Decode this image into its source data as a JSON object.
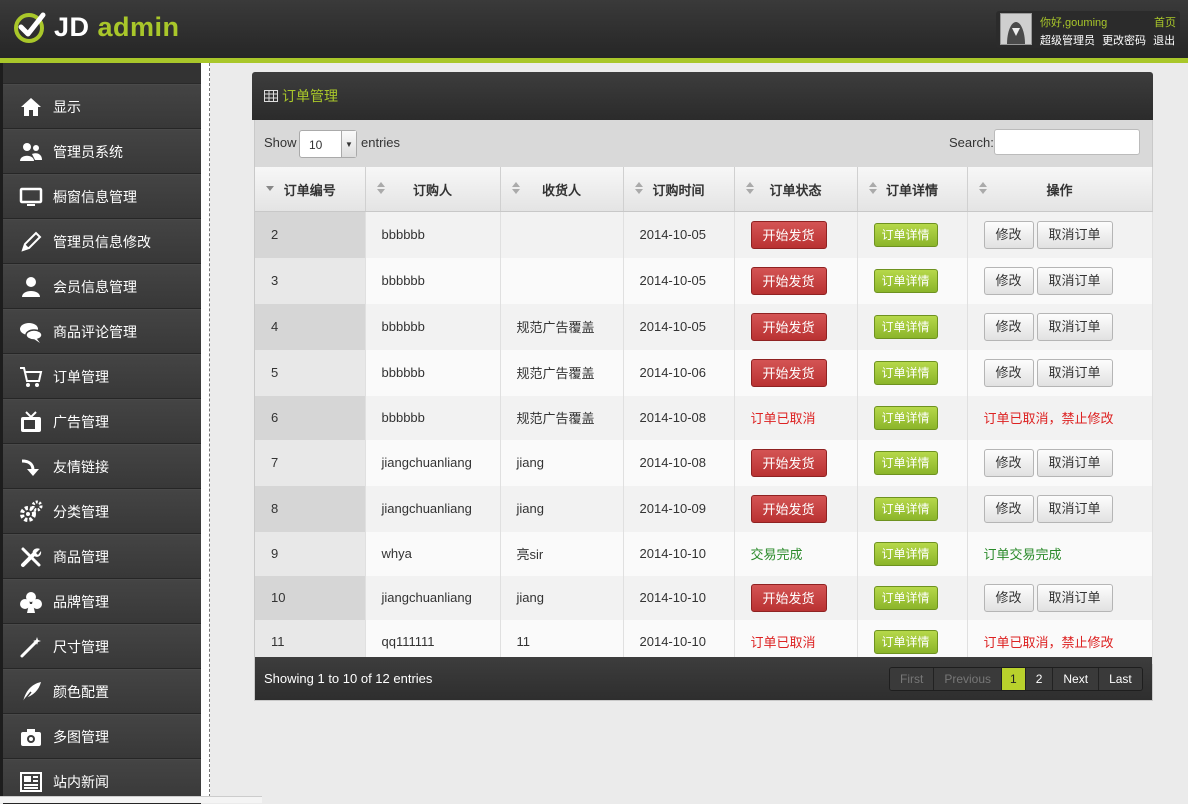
{
  "header": {
    "brand_main": "JD",
    "brand_accent": "admin",
    "greeting": "你好,gouming",
    "home": "首页",
    "role": "超级管理员",
    "change_password": "更改密码",
    "logout": "退出"
  },
  "sidebar": {
    "items": [
      {
        "label": "显示",
        "icon": "home-icon"
      },
      {
        "label": "管理员系统",
        "icon": "users-icon"
      },
      {
        "label": "橱窗信息管理",
        "icon": "monitor-icon"
      },
      {
        "label": "管理员信息修改",
        "icon": "pencil-icon"
      },
      {
        "label": "会员信息管理",
        "icon": "user-icon"
      },
      {
        "label": "商品评论管理",
        "icon": "chat-icon"
      },
      {
        "label": "订单管理",
        "icon": "cart-icon"
      },
      {
        "label": "广告管理",
        "icon": "tv-icon"
      },
      {
        "label": "友情链接",
        "icon": "arrow-icon"
      },
      {
        "label": "分类管理",
        "icon": "gears-icon"
      },
      {
        "label": "商品管理",
        "icon": "tools-icon"
      },
      {
        "label": "品牌管理",
        "icon": "club-icon"
      },
      {
        "label": "尺寸管理",
        "icon": "wand-icon"
      },
      {
        "label": "颜色配置",
        "icon": "feather-icon"
      },
      {
        "label": "多图管理",
        "icon": "camera-icon"
      },
      {
        "label": "站内新闻",
        "icon": "news-icon"
      }
    ]
  },
  "panel": {
    "title": "订单管理",
    "show_label": "Show",
    "page_length": "10",
    "entries_label": "entries",
    "search_label": "Search:",
    "search_value": "",
    "columns": [
      "订单编号",
      "订购人",
      "收货人",
      "订购时间",
      "订单状态",
      "订单详情",
      "操作"
    ],
    "rows": [
      {
        "id": "2",
        "buyer": "bbbbbb",
        "receiver": "",
        "date": "2014-10-05",
        "status": "开始发货",
        "status_type": "button",
        "detail": "订单详情",
        "op_type": "buttons",
        "edit": "修改",
        "cancel": "取消订单"
      },
      {
        "id": "3",
        "buyer": "bbbbbb",
        "receiver": "",
        "date": "2014-10-05",
        "status": "开始发货",
        "status_type": "button",
        "detail": "订单详情",
        "op_type": "buttons",
        "edit": "修改",
        "cancel": "取消订单"
      },
      {
        "id": "4",
        "buyer": "bbbbbb",
        "receiver": "规范广告覆盖",
        "date": "2014-10-05",
        "status": "开始发货",
        "status_type": "button",
        "detail": "订单详情",
        "op_type": "buttons",
        "edit": "修改",
        "cancel": "取消订单"
      },
      {
        "id": "5",
        "buyer": "bbbbbb",
        "receiver": "规范广告覆盖",
        "date": "2014-10-06",
        "status": "开始发货",
        "status_type": "button",
        "detail": "订单详情",
        "op_type": "buttons",
        "edit": "修改",
        "cancel": "取消订单"
      },
      {
        "id": "6",
        "buyer": "bbbbbb",
        "receiver": "规范广告覆盖",
        "date": "2014-10-08",
        "status": "订单已取消",
        "status_type": "red",
        "detail": "订单详情",
        "op_type": "red",
        "op_text": "订单已取消，禁止修改"
      },
      {
        "id": "7",
        "buyer": "jiangchuanliang",
        "receiver": "jiang",
        "date": "2014-10-08",
        "status": "开始发货",
        "status_type": "button",
        "detail": "订单详情",
        "op_type": "buttons",
        "edit": "修改",
        "cancel": "取消订单"
      },
      {
        "id": "8",
        "buyer": "jiangchuanliang",
        "receiver": "jiang",
        "date": "2014-10-09",
        "status": "开始发货",
        "status_type": "button",
        "detail": "订单详情",
        "op_type": "buttons",
        "edit": "修改",
        "cancel": "取消订单"
      },
      {
        "id": "9",
        "buyer": "whya",
        "receiver": "亮sir",
        "date": "2014-10-10",
        "status": "交易完成",
        "status_type": "green",
        "detail": "订单详情",
        "op_type": "green",
        "op_text": "订单交易完成"
      },
      {
        "id": "10",
        "buyer": "jiangchuanliang",
        "receiver": "jiang",
        "date": "2014-10-10",
        "status": "开始发货",
        "status_type": "button",
        "detail": "订单详情",
        "op_type": "buttons",
        "edit": "修改",
        "cancel": "取消订单"
      },
      {
        "id": "11",
        "buyer": "qq111111",
        "receiver": "11",
        "date": "2014-10-10",
        "status": "订单已取消",
        "status_type": "red",
        "detail": "订单详情",
        "op_type": "red",
        "op_text": "订单已取消，禁止修改"
      }
    ],
    "info": "Showing 1 to 10 of 12 entries",
    "pager": {
      "first": "First",
      "previous": "Previous",
      "pages": [
        "1",
        "2"
      ],
      "current": "1",
      "next": "Next",
      "last": "Last"
    }
  },
  "colors": {
    "accent": "#a9c72a",
    "danger": "#c03a3a",
    "success": "#8bb52a"
  }
}
